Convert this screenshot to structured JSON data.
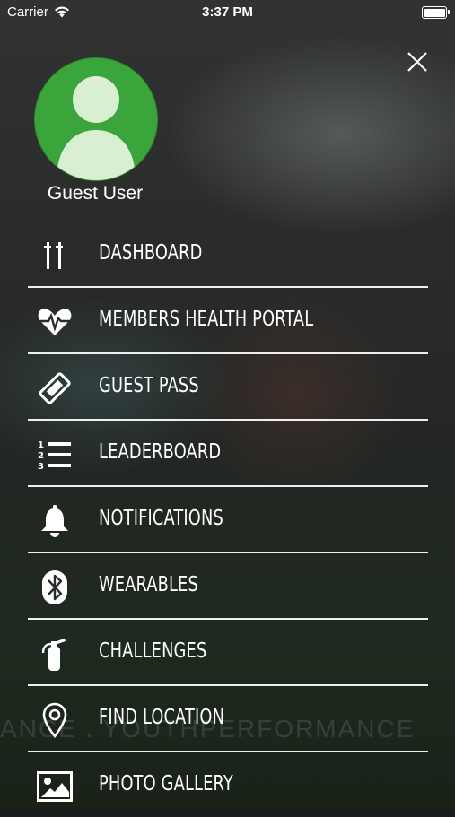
{
  "status_bar": {
    "carrier": "Carrier",
    "time": "3:37 PM"
  },
  "profile": {
    "name": "Guest User"
  },
  "background_watermark": "ANCE . YOUTHPERFORMANCE",
  "menu": [
    {
      "label": "DASHBOARD",
      "icon": "dashboard-icon"
    },
    {
      "label": "MEMBERS HEALTH PORTAL",
      "icon": "heart-pulse-icon"
    },
    {
      "label": "GUEST PASS",
      "icon": "ticket-icon"
    },
    {
      "label": "LEADERBOARD",
      "icon": "ranked-list-icon"
    },
    {
      "label": "NOTIFICATIONS",
      "icon": "bell-icon"
    },
    {
      "label": "WEARABLES",
      "icon": "bluetooth-icon"
    },
    {
      "label": "CHALLENGES",
      "icon": "fire-extinguisher-icon"
    },
    {
      "label": "FIND LOCATION",
      "icon": "location-pin-icon"
    },
    {
      "label": "PHOTO GALLERY",
      "icon": "photo-icon"
    }
  ],
  "colors": {
    "avatar": "#3aa53a",
    "separator": "#ffffff"
  }
}
